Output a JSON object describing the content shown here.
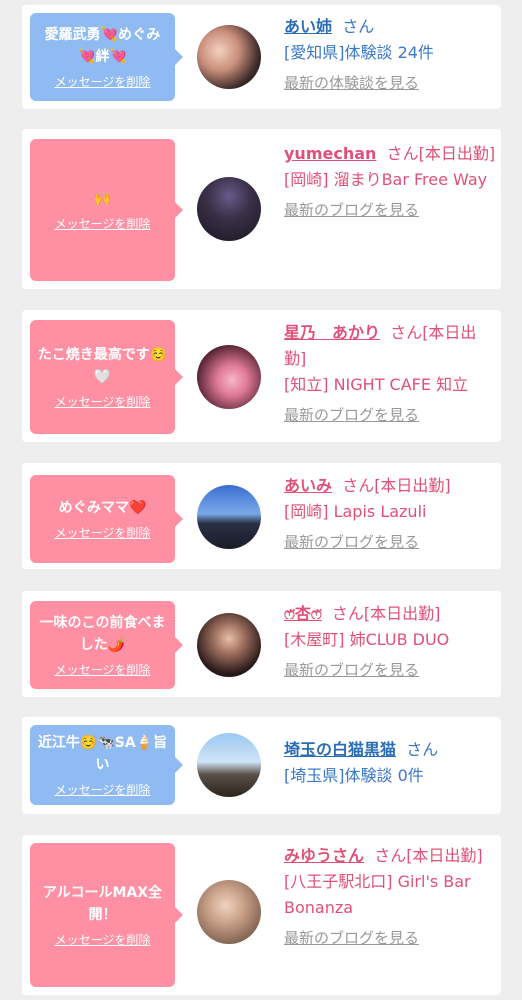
{
  "cards": [
    {
      "theme": "blue",
      "message": "愛羅武勇💘めぐみ💘絆💘",
      "delete_label": "メッセージを削除",
      "name": "あい姉",
      "suffix": "さん",
      "detail": "[愛知県]体験談 24件",
      "latest_label": "最新の体験談を見る"
    },
    {
      "theme": "pink",
      "message": "🙌",
      "delete_label": "メッセージを削除",
      "name": "yumechan",
      "suffix": "さん[本日出勤]",
      "detail": "[岡崎] 溜まりBar Free Way",
      "latest_label": "最新のブログを見る"
    },
    {
      "theme": "pink",
      "message": "たこ焼き最高です☺️🤍",
      "delete_label": "メッセージを削除",
      "name": "星乃　あかり",
      "suffix": "さん[本日出勤]",
      "detail": "[知立] NIGHT CAFE 知立",
      "latest_label": "最新のブログを見る"
    },
    {
      "theme": "pink",
      "message": "めぐみママ❤️",
      "delete_label": "メッセージを削除",
      "name": "あいみ",
      "suffix": "さん[本日出勤]",
      "detail": "[岡崎] Lapis Lazuli",
      "latest_label": "最新のブログを見る"
    },
    {
      "theme": "pink",
      "message": "一味のこの前食べました🌶️",
      "delete_label": "メッセージを削除",
      "name": "ෆ̈杏ෆ̈",
      "suffix": "さん[本日出勤]",
      "detail": "[木屋町] 姉CLUB DUO",
      "latest_label": "最新のブログを見る"
    },
    {
      "theme": "blue",
      "message": "近江牛☺️🐄SA🍦旨い",
      "delete_label": "メッセージを削除",
      "name": "埼玉の白猫黒猫",
      "suffix": "さん",
      "detail": "[埼玉県]体験談 0件",
      "latest_label": ""
    },
    {
      "theme": "pink",
      "message": "アルコールMAX全開！",
      "delete_label": "メッセージを削除",
      "name": "みゆうさん",
      "suffix": "さん[本日出勤]",
      "detail": "[八王子駅北口] Girl's Bar Bonanza",
      "latest_label": "最新のブログを見る"
    }
  ]
}
